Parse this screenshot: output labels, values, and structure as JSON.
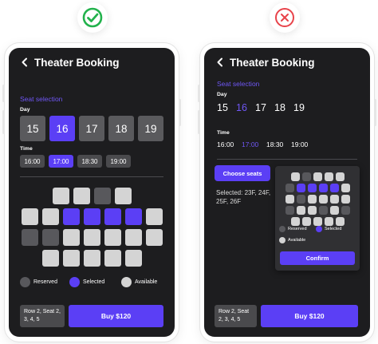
{
  "verdicts": {
    "good": {
      "icon": "check-circle-icon",
      "color": "#22b24c"
    },
    "bad": {
      "icon": "x-circle-icon",
      "color": "#e8434a"
    }
  },
  "good_screen": {
    "title": "Theater Booking",
    "section_label": "Seat selection",
    "day_label": "Day",
    "days": [
      "15",
      "16",
      "17",
      "18",
      "19"
    ],
    "selected_day": "16",
    "time_label": "Time",
    "times": [
      "16:00",
      "17:00",
      "18:30",
      "19:00"
    ],
    "selected_time": "17:00",
    "seat_rows": [
      [
        "available",
        "available",
        "reserved",
        "available"
      ],
      [
        "available",
        "available",
        "selected",
        "selected",
        "selected",
        "selected",
        "available"
      ],
      [
        "reserved",
        "reserved",
        "available",
        "available",
        "available",
        "available",
        "available"
      ],
      [
        "available",
        "available",
        "available",
        "available",
        "available"
      ]
    ],
    "legend": {
      "reserved": "Reserved",
      "selected": "Selected",
      "available": "Available"
    },
    "footer_info": "Row 2, Seat 2, 3, 4, 5",
    "buy_label": "Buy $120"
  },
  "bad_screen": {
    "title": "Theater Booking",
    "section_label": "Seat selection",
    "day_label": "Day",
    "days": [
      "15",
      "16",
      "17",
      "18",
      "19"
    ],
    "selected_day": "16",
    "time_label": "Time",
    "times": [
      "16:00",
      "17:00",
      "18:30",
      "19:00"
    ],
    "selected_time": "17:00",
    "choose_label": "Choose seats",
    "selected_summary": "Selected: 23F, 24F, 25F, 26F",
    "seat_rows": [
      [
        "available",
        "reserved",
        "available",
        "available",
        "available"
      ],
      [
        "reserved",
        "selected",
        "selected",
        "selected",
        "selected",
        "available"
      ],
      [
        "available",
        "reserved",
        "available",
        "available",
        "available",
        "available"
      ],
      [
        "reserved",
        "available",
        "available",
        "reserved",
        "available",
        "reserved"
      ],
      [
        "available",
        "available",
        "available",
        "available",
        "available"
      ]
    ],
    "legend": {
      "reserved": "Reserved",
      "selected": "Selected",
      "available": "Available"
    },
    "confirm_label": "Confirm",
    "footer_info": "Row 2, Seat 2, 3, 4, 5",
    "buy_label": "Buy $120"
  }
}
